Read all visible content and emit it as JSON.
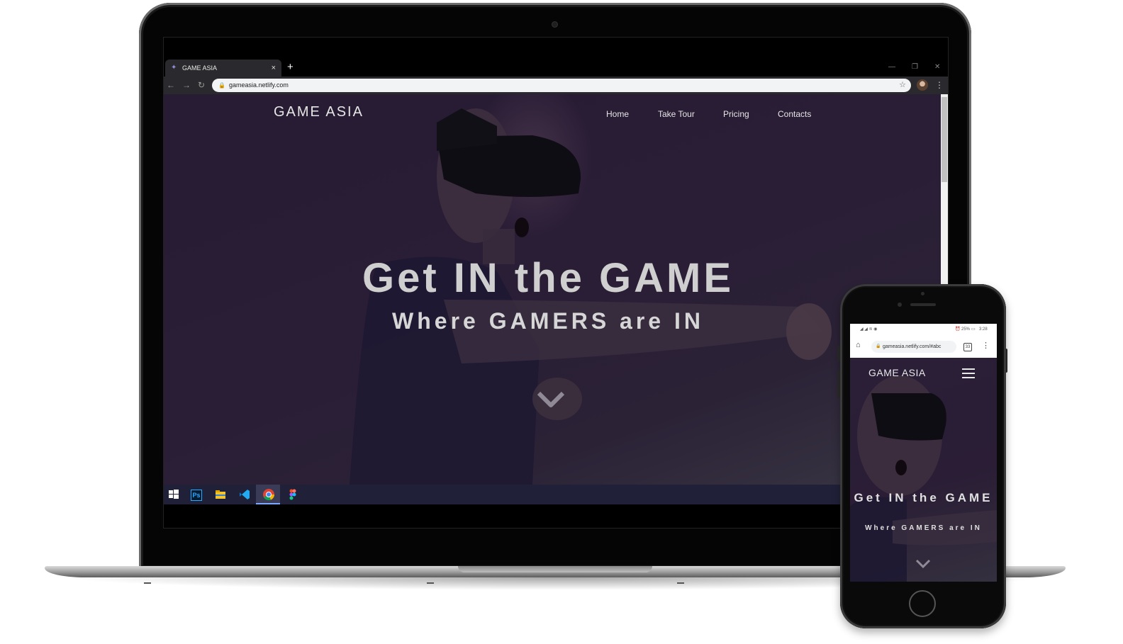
{
  "laptop": {
    "browser": {
      "tab_title": "GAME ASIA",
      "url": "gameasia.netlify.com",
      "new_tab_label": "+",
      "tab_close_label": "×"
    },
    "site": {
      "logo": "GAME ASIA",
      "nav": [
        "Home",
        "Take Tour",
        "Pricing",
        "Contacts"
      ],
      "hero_title": "Get IN the GAME",
      "hero_subtitle": "Where GAMERS are IN"
    },
    "taskbar": {
      "icons": [
        "windows-start-icon",
        "photoshop-icon",
        "file-explorer-icon",
        "vscode-icon",
        "chrome-icon",
        "figma-icon"
      ],
      "photoshop_label": "Ps"
    }
  },
  "phone": {
    "status_time": "3:28",
    "status_battery": "25%",
    "browser": {
      "url": "gameasia.netlify.com/#abc",
      "tab_count": "33"
    },
    "site": {
      "logo": "GAME ASIA",
      "hero_title": "Get IN the GAME",
      "hero_subtitle": "Where GAMERS are IN"
    }
  },
  "colors": {
    "hero_bg": "#2a1d36",
    "taskbar_bg": "#202139",
    "browser_chrome": "#2a2a2e"
  }
}
